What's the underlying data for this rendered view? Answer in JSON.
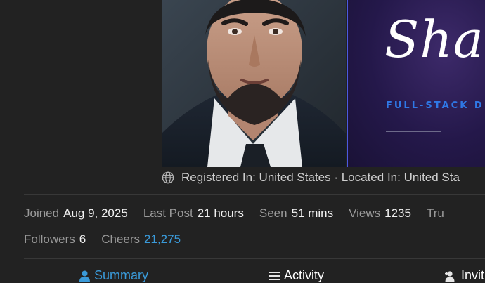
{
  "profile": {
    "banner": {
      "script_text": "Sha",
      "subtitle": "FULL-STACK D"
    },
    "location_text": "Registered In: United States · Located In: United Sta"
  },
  "stats_row1": [
    {
      "label": "Joined",
      "value": "Aug 9, 2025"
    },
    {
      "label": "Last Post",
      "value": "21 hours"
    },
    {
      "label": "Seen",
      "value": "51 mins"
    },
    {
      "label": "Views",
      "value": "1235"
    },
    {
      "label": "Tru",
      "value": ""
    }
  ],
  "stats_row2": [
    {
      "label": "Followers",
      "value": "6"
    },
    {
      "label": "Cheers",
      "value": "21,275"
    }
  ],
  "tabs": [
    {
      "label": "Summary",
      "icon": "user-icon",
      "active": true
    },
    {
      "label": "Activity",
      "icon": "list-icon",
      "active": false
    },
    {
      "label": "Invit",
      "icon": "user-plus-icon",
      "active": false
    }
  ],
  "colors": {
    "accent": "#3a9ad9",
    "background": "#222222",
    "banner_accent": "#2f78e6"
  }
}
